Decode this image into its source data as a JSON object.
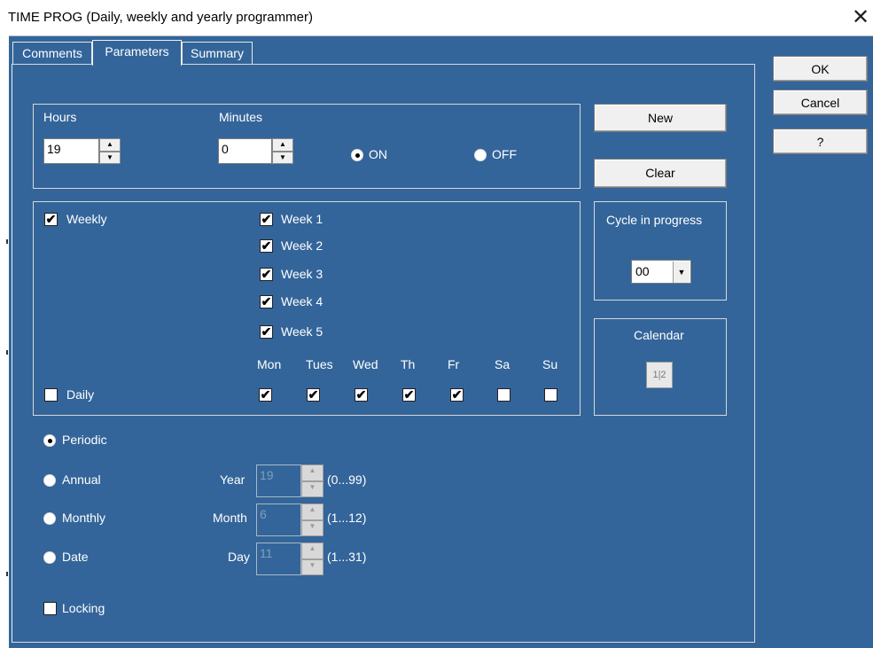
{
  "window": {
    "title": "TIME PROG (Daily, weekly and yearly programmer)",
    "close_glyph": "✕"
  },
  "tabs": [
    {
      "label": "Comments"
    },
    {
      "label": "Parameters"
    },
    {
      "label": "Summary"
    }
  ],
  "dialog_buttons": {
    "ok": "OK",
    "cancel": "Cancel",
    "help": "?"
  },
  "time": {
    "hours_label": "Hours",
    "hours_value": "19",
    "minutes_label": "Minutes",
    "minutes_value": "0",
    "on_label": "ON",
    "off_label": "OFF",
    "selected": "ON"
  },
  "actions": {
    "new": "New",
    "clear": "Clear"
  },
  "cycle": {
    "label": "Cycle in progress",
    "value": "00"
  },
  "calendar": {
    "label": "Calendar",
    "icon_text": "1|2"
  },
  "weekly": {
    "weekly_label": "Weekly",
    "weekly_checked": true,
    "weeks": [
      {
        "label": "Week 1",
        "checked": true
      },
      {
        "label": "Week 2",
        "checked": true
      },
      {
        "label": "Week 3",
        "checked": true
      },
      {
        "label": "Week 4",
        "checked": true
      },
      {
        "label": "Week 5",
        "checked": true
      }
    ],
    "daily_label": "Daily",
    "daily_checked": false,
    "days": [
      {
        "label": "Mon",
        "checked": true
      },
      {
        "label": "Tues",
        "checked": true
      },
      {
        "label": "Wed",
        "checked": true
      },
      {
        "label": "Th",
        "checked": true
      },
      {
        "label": "Fr",
        "checked": true
      },
      {
        "label": "Sa",
        "checked": false
      },
      {
        "label": "Su",
        "checked": false
      }
    ]
  },
  "mode": {
    "periodic": "Periodic",
    "annual": "Annual",
    "monthly": "Monthly",
    "date": "Date",
    "selected": "Periodic"
  },
  "date_fields": {
    "year_label": "Year",
    "year_value": "19",
    "year_range": "(0...99)",
    "month_label": "Month",
    "month_value": "6",
    "month_range": "(1...12)",
    "day_label": "Day",
    "day_value": "11",
    "day_range": "(1...31)"
  },
  "locking": {
    "label": "Locking",
    "checked": false
  }
}
